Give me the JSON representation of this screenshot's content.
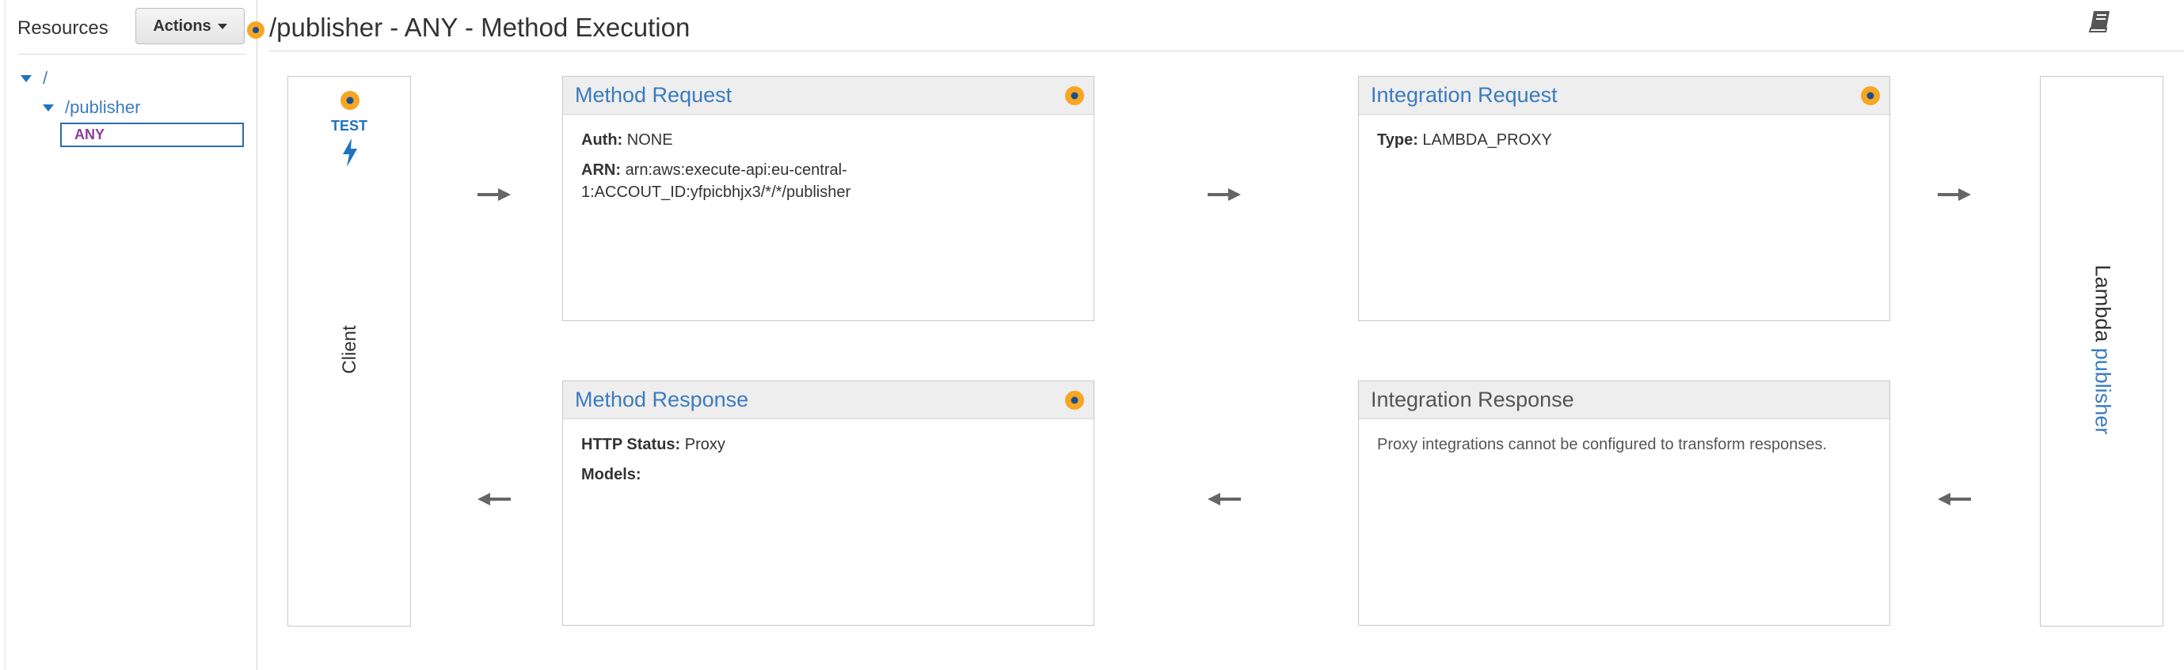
{
  "sidebar": {
    "title": "Resources",
    "actions_label": "Actions",
    "tree": {
      "root": "/",
      "publisher": "/publisher",
      "method": "ANY"
    }
  },
  "header": {
    "title": "/publisher - ANY - Method Execution",
    "icons": [
      "status-dot-icon",
      "book-icon"
    ]
  },
  "client": {
    "test_label": "TEST",
    "label": "Client",
    "icons": [
      "status-dot-icon",
      "lightning-icon"
    ]
  },
  "method_request": {
    "title": "Method Request",
    "auth_label": "Auth:",
    "auth_value": "NONE",
    "arn_label": "ARN:",
    "arn_value_line1": "arn:aws:execute-api:eu-central-",
    "arn_value_line2": "1:ACCOUT_ID:yfpicbhjx3/*/*/publisher"
  },
  "integration_request": {
    "title": "Integration Request",
    "type_label": "Type:",
    "type_value": "LAMBDA_PROXY"
  },
  "method_response": {
    "title": "Method Response",
    "status_label": "HTTP Status:",
    "status_value": "Proxy",
    "models_label": "Models:"
  },
  "integration_response": {
    "title": "Integration Response",
    "note": "Proxy integrations cannot be configured to transform responses."
  },
  "lambda": {
    "prefix": "Lambda",
    "function_name": "publisher"
  },
  "colors": {
    "link": "#3b7bc0",
    "status_dot": "#f5a623",
    "method_badge": "#8e3a9d",
    "arrow": "#666666"
  }
}
